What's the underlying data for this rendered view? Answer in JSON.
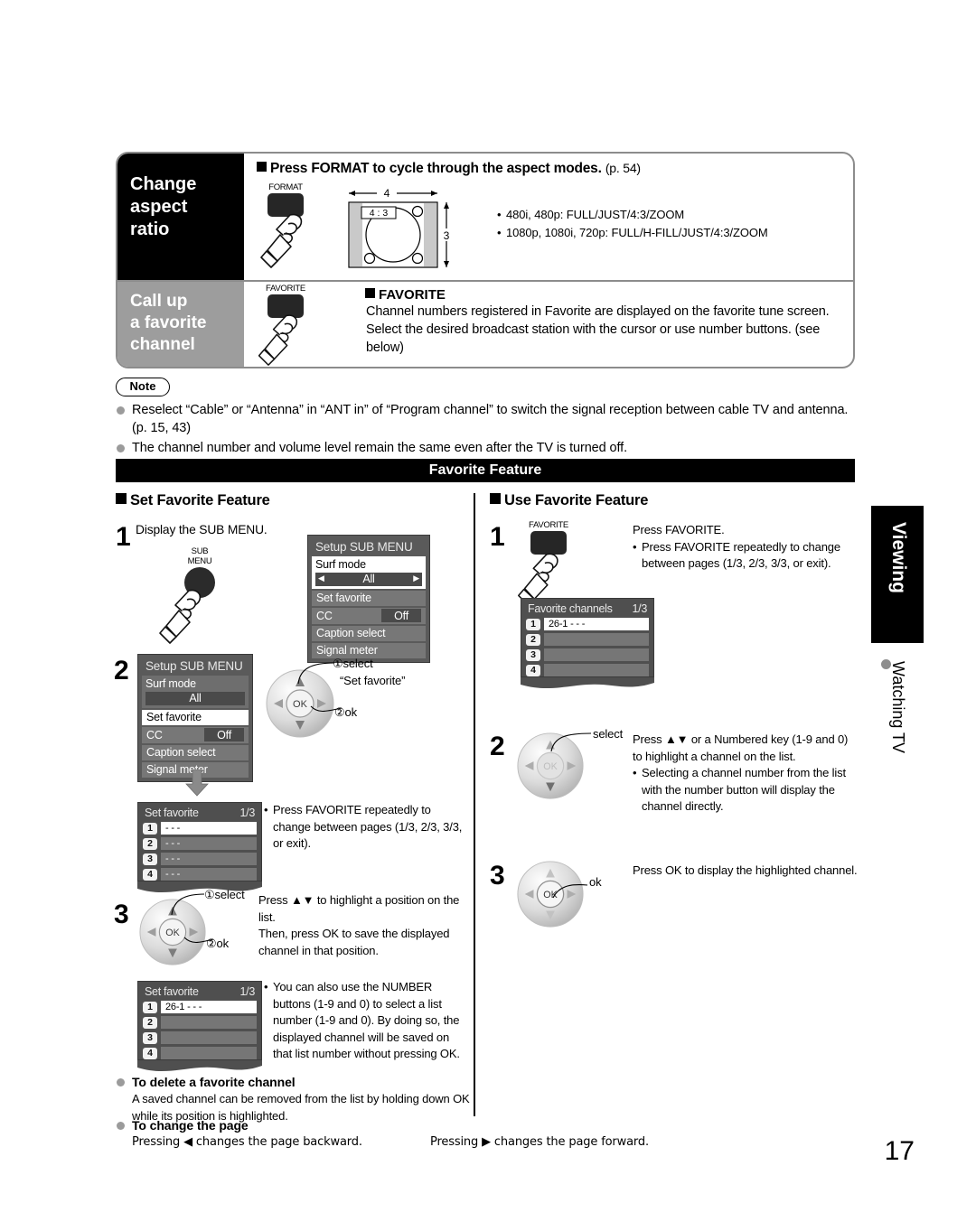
{
  "top_panel": {
    "aspect": {
      "side_label": "Change\naspect\nratio",
      "side_label_lines": [
        "Change",
        "aspect",
        "ratio"
      ],
      "heading": "Press FORMAT to cycle through the aspect modes.",
      "heading_page_ref": "(p. 54)",
      "key_label": "FORMAT",
      "diagram": {
        "width_label": "4",
        "height_label": "3",
        "ratio_label": "4 : 3"
      },
      "modes": [
        "480i, 480p:  FULL/JUST/4:3/ZOOM",
        "1080p, 1080i, 720p:  FULL/H-FILL/JUST/4:3/ZOOM"
      ]
    },
    "favorite": {
      "side_label_lines": [
        "Call up",
        "a favorite",
        "channel"
      ],
      "key_label": "FAVORITE",
      "heading": "FAVORITE",
      "body": "Channel numbers registered in Favorite are displayed on the favorite tune screen. Select the desired broadcast station with the cursor or use number buttons. (see below)"
    }
  },
  "note": {
    "label": "Note",
    "items": [
      "Reselect “Cable” or “Antenna” in “ANT in” of “Program channel” to switch the signal reception between cable TV and antenna. (p. 15, 43)",
      "The channel number and volume level remain the same even after the TV is turned off."
    ]
  },
  "section_bar": {
    "title": "Favorite Feature"
  },
  "set_favorite": {
    "title": "Set Favorite Feature",
    "step1": {
      "num": "1",
      "text": "Display the SUB MENU.",
      "key_label_line1": "SUB",
      "key_label_line2": "MENU",
      "menu": {
        "title": "Setup SUB MENU",
        "rows": [
          {
            "label": "Surf mode",
            "value": "All",
            "type": "surf",
            "highlight": true
          },
          {
            "label": "Set favorite",
            "value": "",
            "type": "plain",
            "highlight": false
          },
          {
            "label": "CC",
            "value": "Off",
            "type": "value",
            "highlight": false
          },
          {
            "label": "Caption select",
            "value": "",
            "type": "plain",
            "highlight": false
          },
          {
            "label": "Signal meter",
            "value": "",
            "type": "plain",
            "highlight": false
          }
        ]
      }
    },
    "step2": {
      "num": "2",
      "menu": {
        "title": "Setup SUB MENU",
        "rows": [
          {
            "label": "Surf mode",
            "value": "All",
            "type": "surf",
            "highlight": false
          },
          {
            "label": "Set favorite",
            "value": "",
            "type": "plain",
            "highlight": true
          },
          {
            "label": "CC",
            "value": "Off",
            "type": "value",
            "highlight": false
          },
          {
            "label": "Caption select",
            "value": "",
            "type": "plain",
            "highlight": false
          },
          {
            "label": "Signal meter",
            "value": "",
            "type": "plain",
            "highlight": false
          }
        ]
      },
      "pad_note_1": "①select",
      "pad_note_1b": "“Set favorite”",
      "pad_note_2": "②ok",
      "pad_ok": "OK",
      "list": {
        "title": "Set favorite",
        "page": "1/3",
        "rows": [
          {
            "idx": "1",
            "value": "- - -",
            "highlight": true
          },
          {
            "idx": "2",
            "value": "- - -",
            "highlight": false
          },
          {
            "idx": "3",
            "value": "- - -",
            "highlight": false
          },
          {
            "idx": "4",
            "value": "- - -",
            "highlight": false
          }
        ]
      },
      "tip": "Press FAVORITE repeatedly to change between pages (1/3, 2/3, 3/3, or exit)."
    },
    "step3": {
      "num": "3",
      "pad_note_1": "①select",
      "pad_note_2": "②ok",
      "pad_ok": "OK",
      "text": "Press ▲▼ to highlight a position on the list.\nThen, press OK to save the displayed channel in that position.",
      "text_line1": "Press ▲▼ to highlight a position on the list.",
      "text_line2": "Then, press OK to save the displayed channel in that position.",
      "list": {
        "title": "Set favorite",
        "page": "1/3",
        "rows": [
          {
            "idx": "1",
            "value": "26-1      - - -",
            "highlight": true
          },
          {
            "idx": "2",
            "value": "",
            "highlight": false
          },
          {
            "idx": "3",
            "value": "",
            "highlight": false
          },
          {
            "idx": "4",
            "value": "",
            "highlight": false
          }
        ]
      },
      "tip": "You can also use the NUMBER buttons (1-9 and 0) to select a list number (1-9 and 0). By doing so, the displayed channel will be saved on that list number without pressing OK."
    }
  },
  "use_favorite": {
    "title": "Use Favorite Feature",
    "step1": {
      "num": "1",
      "key_label": "FAVORITE",
      "text": "Press FAVORITE.",
      "tip": "Press FAVORITE repeatedly to change between pages (1/3, 2/3, 3/3, or exit).",
      "list": {
        "title": "Favorite channels",
        "page": "1/3",
        "rows": [
          {
            "idx": "1",
            "value": "26-1      - - -",
            "highlight": true
          },
          {
            "idx": "2",
            "value": "",
            "highlight": false
          },
          {
            "idx": "3",
            "value": "",
            "highlight": false
          },
          {
            "idx": "4",
            "value": "",
            "highlight": false
          }
        ]
      }
    },
    "step2": {
      "num": "2",
      "pad_note": "select",
      "pad_ok": "OK",
      "text": "Press ▲▼ or a Numbered key (1-9 and 0) to highlight a channel on the list.",
      "tip": "Selecting a channel number from the list with the number button will display the channel directly."
    },
    "step3": {
      "num": "3",
      "pad_note": "ok",
      "pad_ok": "OK",
      "text": "Press OK to display the highlighted channel."
    }
  },
  "footer": {
    "delete_title": "To delete a favorite channel",
    "delete_body": "A saved channel can be removed from the list by holding down OK while its position is highlighted.",
    "page_title": "To change the page",
    "page_back": "Pressing ◀ changes the page backward.",
    "page_fwd": "Pressing ▶ changes the page forward."
  },
  "sidebar": {
    "tab_label": "Viewing",
    "sub_label": "Watching TV"
  },
  "page_number": "17"
}
